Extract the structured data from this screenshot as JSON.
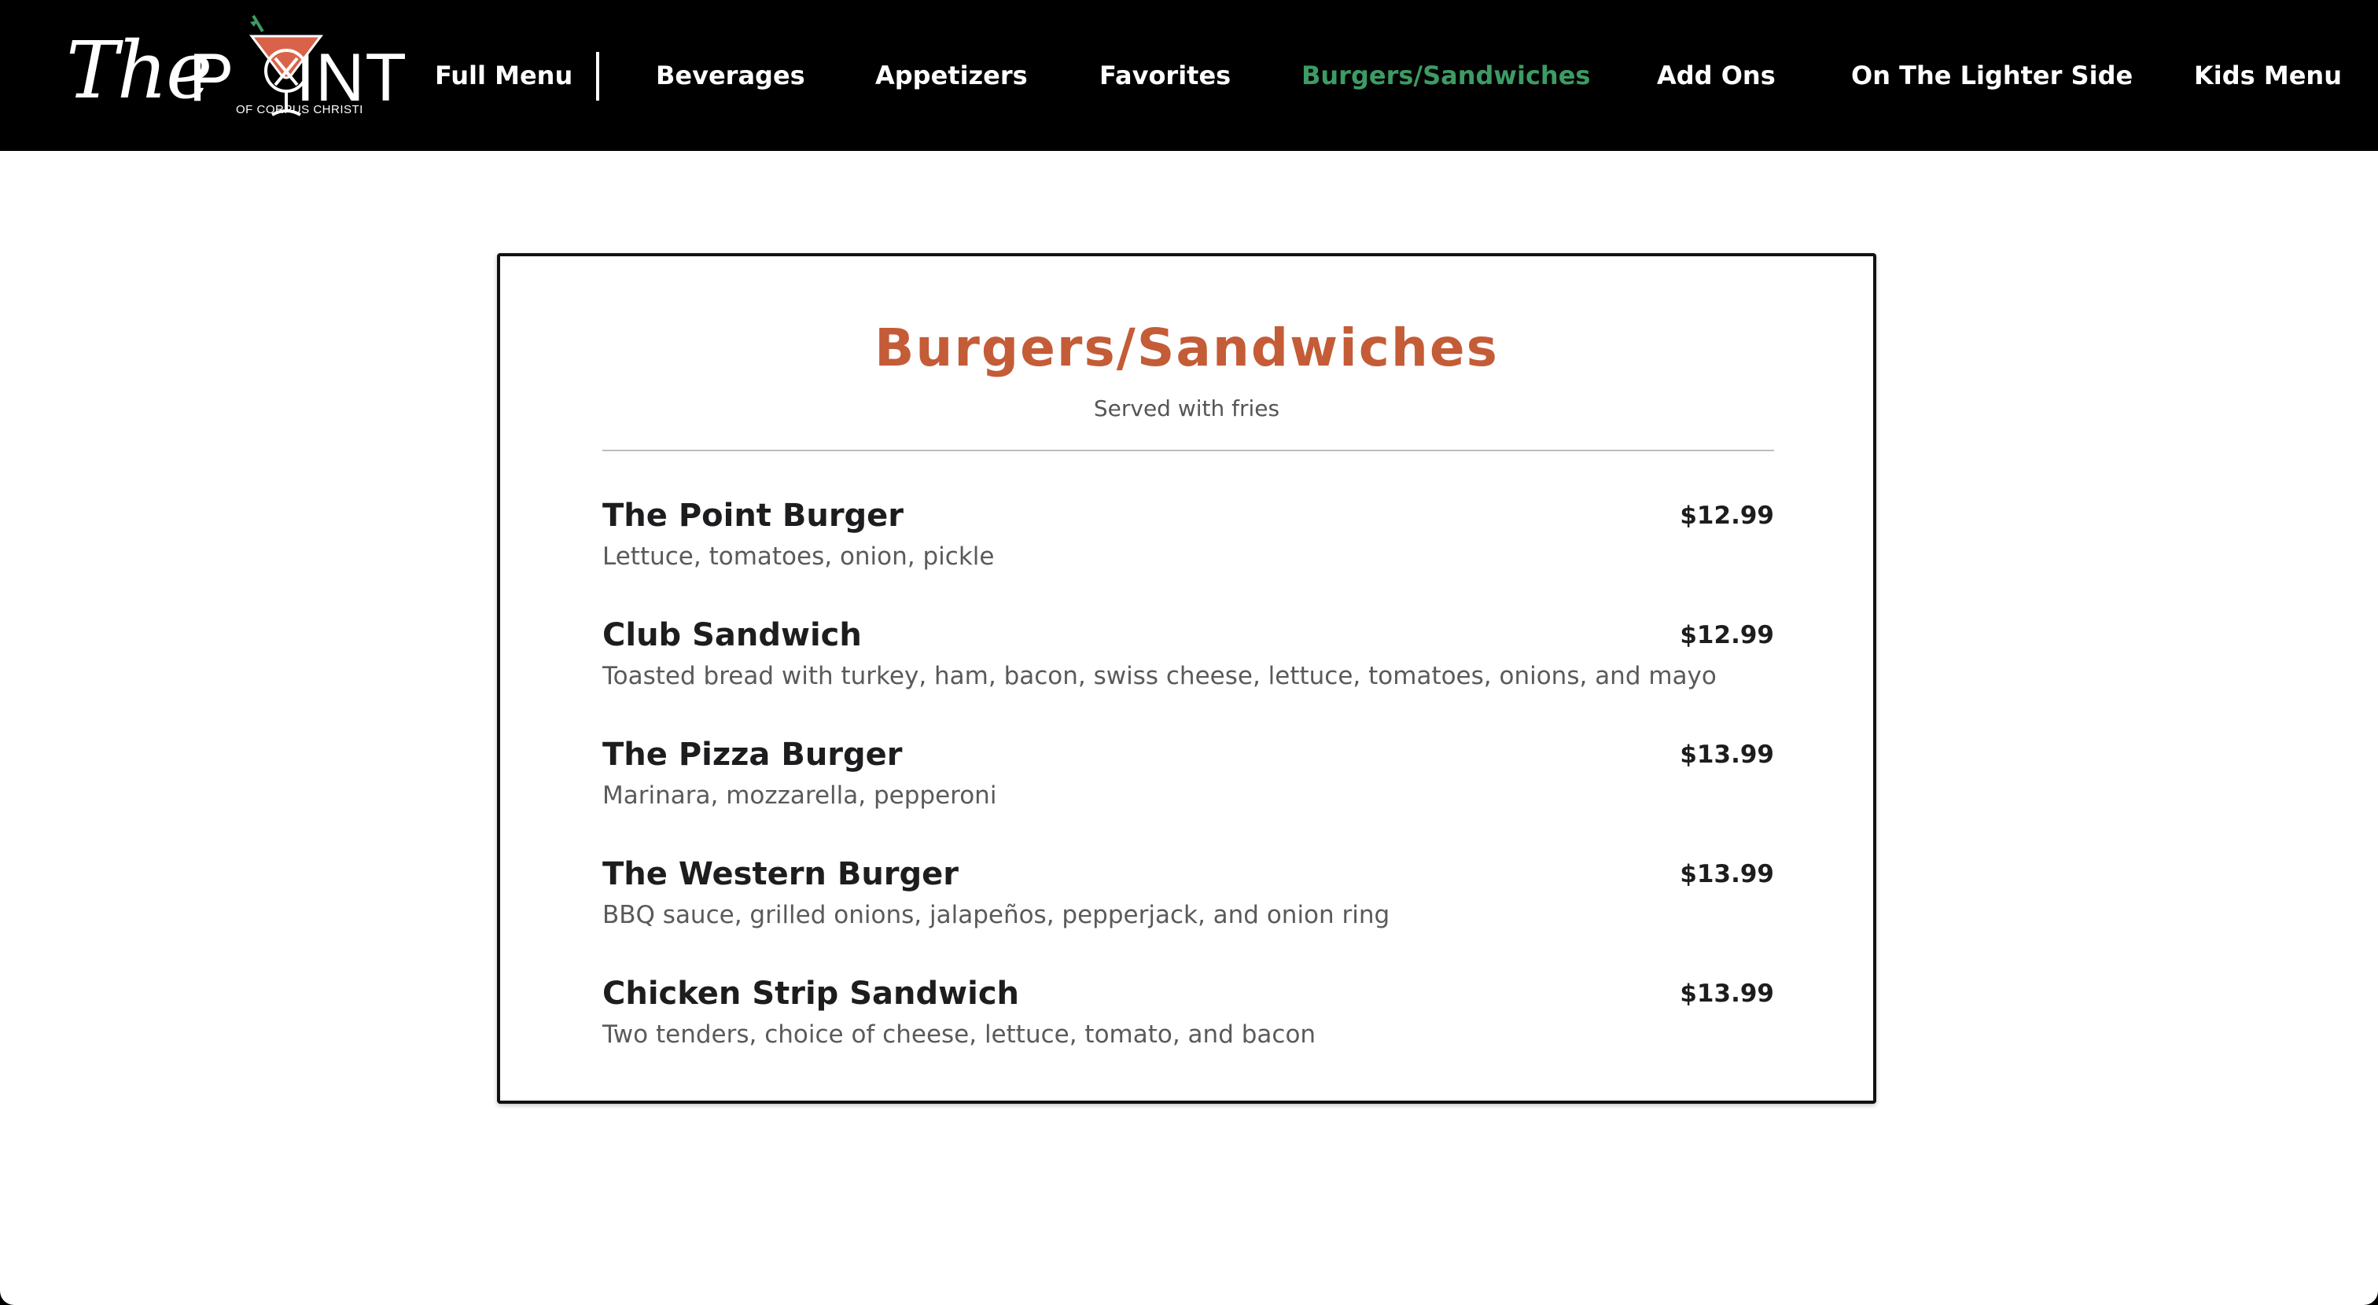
{
  "brand": {
    "script": "The",
    "block_left": "P",
    "block_right": "INT",
    "tagline": "OF CORPUS CHRISTI",
    "accent_glass": "#d9634a",
    "accent_garnish": "#3d9b64"
  },
  "nav": {
    "items": [
      {
        "label": "Full Menu"
      },
      {
        "label": "Beverages"
      },
      {
        "label": "Appetizers"
      },
      {
        "label": "Favorites"
      },
      {
        "label": "Burgers/Sandwiches",
        "active": true
      },
      {
        "label": "Add Ons"
      },
      {
        "label": "On The Lighter Side"
      },
      {
        "label": "Kids Menu"
      }
    ],
    "active_color": "#3d9b64"
  },
  "section": {
    "title": "Burgers/Sandwiches",
    "subtitle": "Served with fries",
    "title_color": "#c45c37",
    "items": [
      {
        "name": "The Point Burger",
        "price": "$12.99",
        "description": "Lettuce, tomatoes, onion, pickle"
      },
      {
        "name": "Club Sandwich",
        "price": "$12.99",
        "description": "Toasted bread with turkey, ham, bacon, swiss cheese, lettuce, tomatoes, onions, and mayo"
      },
      {
        "name": "The Pizza Burger",
        "price": "$13.99",
        "description": "Marinara, mozzarella, pepperoni"
      },
      {
        "name": "The Western Burger",
        "price": "$13.99",
        "description": "BBQ sauce, grilled onions, jalapeños, pepperjack, and onion ring"
      },
      {
        "name": "Chicken Strip Sandwich",
        "price": "$13.99",
        "description": "Two tenders, choice of cheese, lettuce, tomato, and bacon"
      }
    ]
  }
}
